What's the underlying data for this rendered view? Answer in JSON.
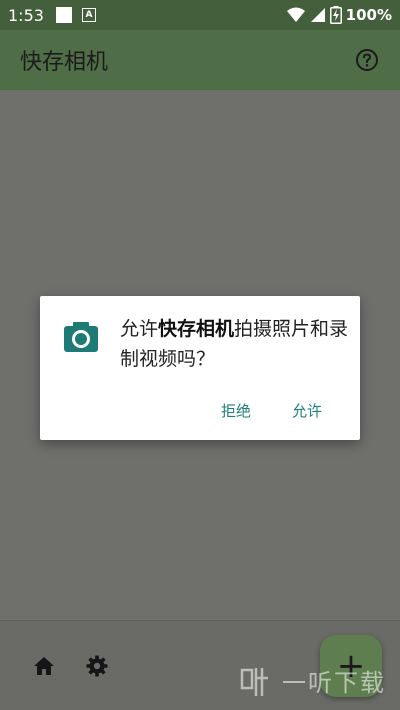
{
  "status_bar": {
    "time": "1:53",
    "battery": "100%",
    "notification_icons": [
      "white-square-icon",
      "a-badge-icon"
    ],
    "system_icons": [
      "wifi-icon",
      "signal-icon",
      "battery-charging-icon"
    ]
  },
  "app_bar": {
    "title": "快存相机",
    "help_icon": "help-circle-icon"
  },
  "dialog": {
    "icon": "camera-icon",
    "message_prefix": "允许",
    "message_app_name": "快存相机",
    "message_suffix": "拍摄照片和录制视频吗？",
    "deny_label": "拒绝",
    "allow_label": "允许"
  },
  "bottom_bar": {
    "icons": [
      "home-icon",
      "settings-icon"
    ],
    "fab_label": "+"
  },
  "watermark": {
    "text": "一听下载"
  },
  "colors": {
    "status_bar": "#445f3b",
    "app_bar": "#4f6e47",
    "scrim": "#6f6f6b",
    "accent": "#1d7f7a",
    "fab": "#5f7e50"
  }
}
